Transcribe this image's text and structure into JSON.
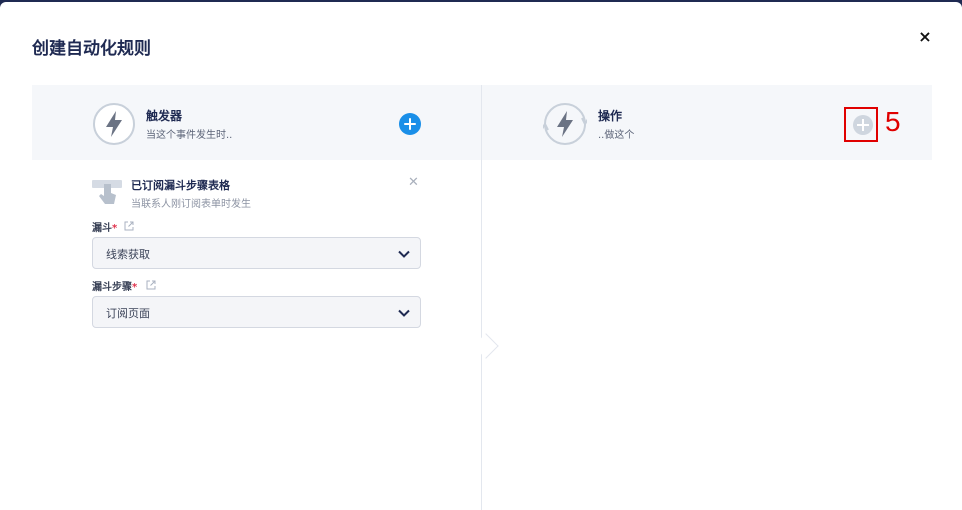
{
  "modal": {
    "title": "创建自动化规则",
    "close_label": "×"
  },
  "trigger_panel": {
    "title": "触发器",
    "subtitle": "当这个事件发生时.."
  },
  "action_panel": {
    "title": "操作",
    "subtitle": "..做这个",
    "annotation_number": "5"
  },
  "selected_trigger": {
    "title": "已订阅漏斗步骤表格",
    "description": "当联系人刚订阅表单时发生",
    "remove_label": "✕"
  },
  "fields": {
    "funnel": {
      "label": "漏斗",
      "required_mark": "*",
      "value": "线索获取"
    },
    "funnel_step": {
      "label": "漏斗步骤",
      "required_mark": "*",
      "value": "订阅页面"
    }
  },
  "colors": {
    "accent": "#1a8fe8",
    "title": "#1f2a52",
    "annotation": "#e00000"
  },
  "icons": [
    "lightning-icon",
    "plus-icon",
    "hand-pointer-icon",
    "close-icon",
    "external-link-icon",
    "chevron-down-icon"
  ]
}
